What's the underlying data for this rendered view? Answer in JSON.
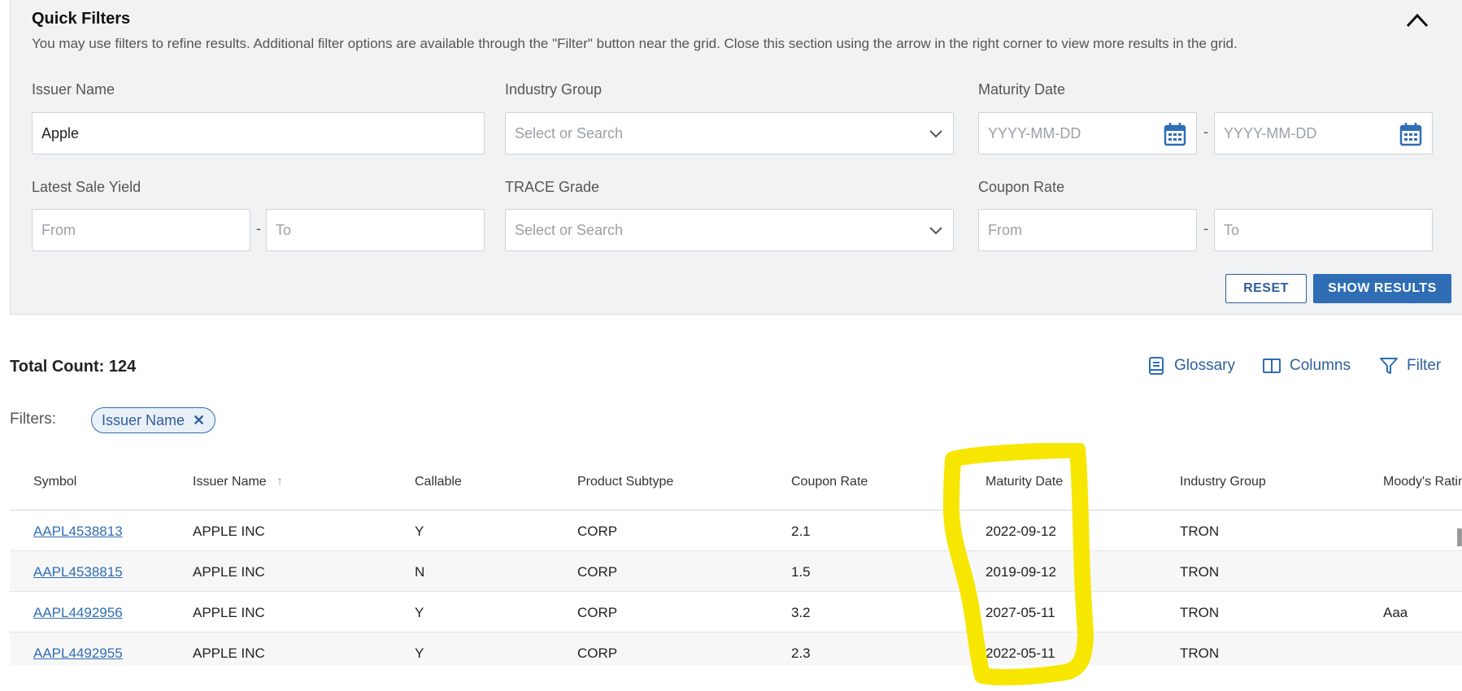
{
  "quick_filters": {
    "title": "Quick Filters",
    "description": "You may use filters to refine results. Additional filter options are available through the \"Filter\" button near the grid. Close this section using the arrow in the right corner to view more results in the grid.",
    "issuer_name": {
      "label": "Issuer Name",
      "value": "Apple"
    },
    "industry_group": {
      "label": "Industry Group",
      "placeholder": "Select or Search"
    },
    "maturity_date": {
      "label": "Maturity Date",
      "from_placeholder": "YYYY-MM-DD",
      "to_placeholder": "YYYY-MM-DD",
      "separator": "-"
    },
    "latest_sale_yield": {
      "label": "Latest Sale Yield",
      "from_placeholder": "From",
      "to_placeholder": "To",
      "separator": "-"
    },
    "trace_grade": {
      "label": "TRACE Grade",
      "placeholder": "Select or Search"
    },
    "coupon_rate": {
      "label": "Coupon Rate",
      "from_placeholder": "From",
      "to_placeholder": "To",
      "separator": "-"
    },
    "reset_label": "RESET",
    "show_results_label": "SHOW RESULTS"
  },
  "results": {
    "total_count_label": "Total Count: 124",
    "toolbar": {
      "glossary": "Glossary",
      "columns": "Columns",
      "filter": "Filter"
    },
    "filters_label": "Filters:",
    "active_filter_chip": "Issuer Name",
    "chip_remove": "✕"
  },
  "grid": {
    "columns": [
      "Symbol",
      "Issuer Name",
      "Callable",
      "Product Subtype",
      "Coupon Rate",
      "Maturity Date",
      "Industry Group",
      "Moody's Ratin"
    ],
    "sort_indicator": "↑",
    "rows": [
      [
        "AAPL4538813",
        "APPLE INC",
        "Y",
        "CORP",
        "2.1",
        "2022-09-12",
        "TRON",
        ""
      ],
      [
        "AAPL4538815",
        "APPLE INC",
        "N",
        "CORP",
        "1.5",
        "2019-09-12",
        "TRON",
        ""
      ],
      [
        "AAPL4492956",
        "APPLE INC",
        "Y",
        "CORP",
        "3.2",
        "2027-05-11",
        "TRON",
        "Aaa"
      ],
      [
        "AAPL4492955",
        "APPLE INC",
        "Y",
        "CORP",
        "2.3",
        "2022-05-11",
        "TRON",
        ""
      ]
    ]
  },
  "colors": {
    "accent": "#2f6db5",
    "panel_bg": "#f1f2f3",
    "highlight": "#f7e600"
  }
}
